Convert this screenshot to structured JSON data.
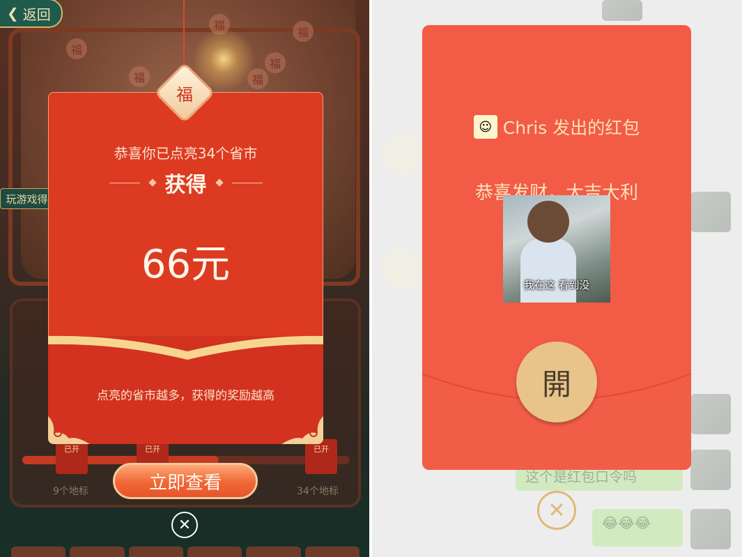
{
  "left_screen": {
    "back_label": "返回",
    "side_tag": "玩游戏得",
    "map_fu_char": "福",
    "popup": {
      "badge_char": "福",
      "congrats_text": "恭喜你已点亮34个省市",
      "earned_label": "获得",
      "amount": "66元",
      "hint_text": "点亮的省市越多，获得的奖励越高",
      "view_button": "立即查看"
    },
    "city_cards": [
      "已开",
      "已开",
      "已开"
    ],
    "counts": [
      "9个地标",
      "34个地标"
    ],
    "close_glyph": "✕"
  },
  "right_screen": {
    "red_packet": {
      "sender_avatar_glyph": "☺",
      "sender_text": "Chris 发出的红包",
      "blessing": "恭喜发财，大吉大利",
      "photo_caption": "我在这 看到没",
      "open_button": "開"
    },
    "background_chat": {
      "message_1": "这个是红包口令吗",
      "message_2": "😂😂😂"
    },
    "close_glyph": "✕"
  },
  "colors": {
    "left_envelope": "#dd3a22",
    "right_packet": "#f25b45",
    "open_button": "#e8c48a",
    "gold": "#e0b876"
  }
}
